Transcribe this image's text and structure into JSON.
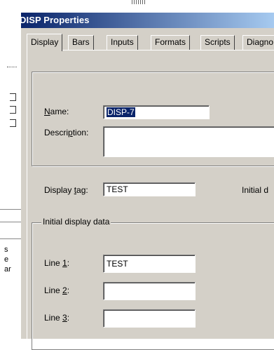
{
  "window": {
    "title": "DISP Properties"
  },
  "tabs": [
    {
      "label": "Display",
      "active": true
    },
    {
      "label": "Bars"
    },
    {
      "label": "Inputs"
    },
    {
      "label": "Formats"
    },
    {
      "label": "Scripts"
    },
    {
      "label": "Diagno"
    }
  ],
  "display_tab": {
    "name": {
      "label_pre": "",
      "label_key": "N",
      "label_post": "ame:",
      "value": "DISP-7"
    },
    "description": {
      "label_pre": "Descri",
      "label_key": "p",
      "label_post": "tion:",
      "value": ""
    },
    "display_tag": {
      "label_pre": "Display ",
      "label_key": "t",
      "label_post": "ag:",
      "value": "TEST"
    },
    "initial_right_label": "Initial d",
    "initial_group": {
      "title": "Initial display data",
      "lines": [
        {
          "label_pre": "Line ",
          "label_key": "1",
          "label_post": ":",
          "value": "TEST"
        },
        {
          "label_pre": "Line ",
          "label_key": "2",
          "label_post": ":",
          "value": ""
        },
        {
          "label_pre": "Line ",
          "label_key": "3",
          "label_post": ":",
          "value": ""
        }
      ]
    }
  },
  "background_window": {
    "glyphs": [
      "s",
      "e",
      "ar"
    ]
  }
}
